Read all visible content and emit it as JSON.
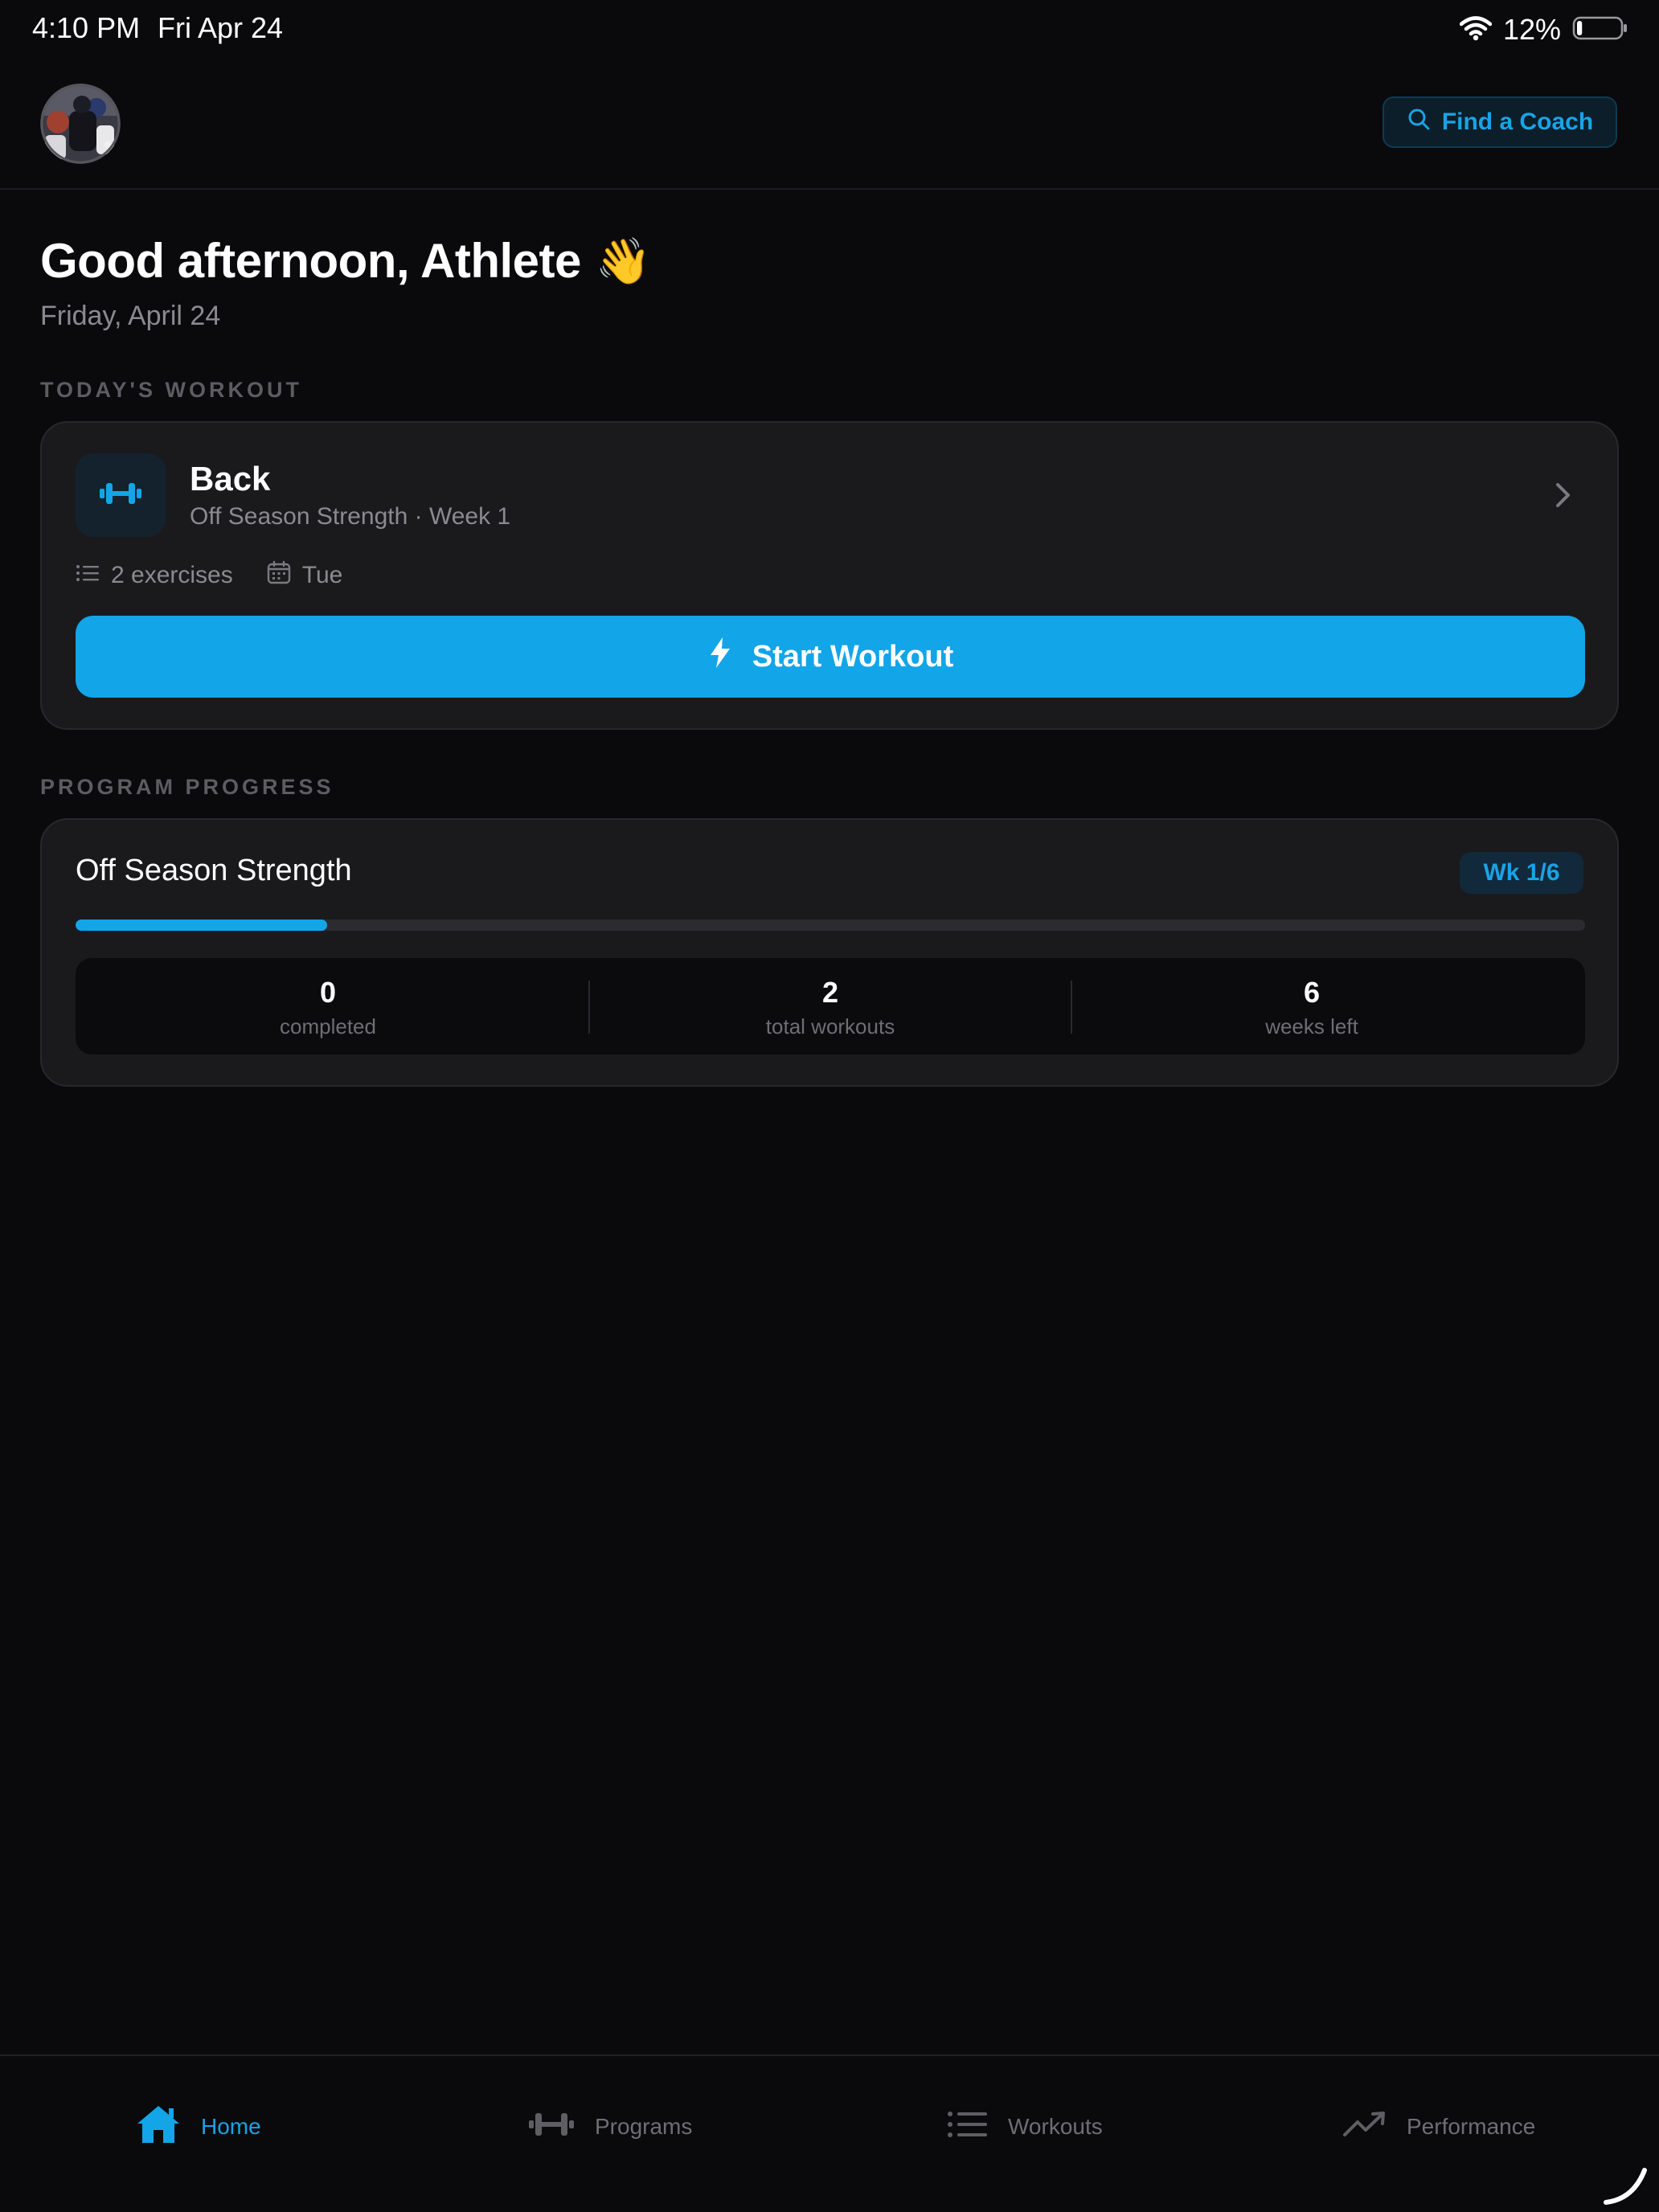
{
  "status_bar": {
    "time": "4:10 PM",
    "date": "Fri Apr 24",
    "battery_percent": "12%",
    "battery_level": 0.12,
    "wifi_icon": "wifi-icon",
    "battery_icon": "battery-icon"
  },
  "header": {
    "avatar_icon": "avatar-photo",
    "coach_button_label": "Find a Coach",
    "coach_button_icon": "search-icon"
  },
  "greeting": {
    "text": "Good afternoon, Athlete",
    "emoji": "👋",
    "date": "Friday, April 24"
  },
  "todays_workout": {
    "section_label": "TODAY'S WORKOUT",
    "icon": "dumbbell-icon",
    "title": "Back",
    "subtitle": "Off Season Strength · Week 1",
    "exercises": "2 exercises",
    "day": "Tue",
    "start_label": "Start Workout"
  },
  "program_progress": {
    "section_label": "PROGRAM PROGRESS",
    "title": "Off Season Strength",
    "week_badge": "Wk 1/6",
    "progress_fraction": 0.1667,
    "stats": [
      {
        "value": "0",
        "label": "completed"
      },
      {
        "value": "2",
        "label": "total workouts"
      },
      {
        "value": "6",
        "label": "weeks left"
      }
    ]
  },
  "tab_bar": {
    "tabs": [
      {
        "label": "Home",
        "icon": "home-icon",
        "active": true
      },
      {
        "label": "Programs",
        "icon": "dumbbell-icon",
        "active": false
      },
      {
        "label": "Workouts",
        "icon": "list-icon",
        "active": false
      },
      {
        "label": "Performance",
        "icon": "trending-up-icon",
        "active": false
      }
    ]
  },
  "colors": {
    "background": "#0a0a0c",
    "card": "#1a1a1d",
    "accent": "#12a5e8",
    "muted_text": "#8a8a90"
  }
}
